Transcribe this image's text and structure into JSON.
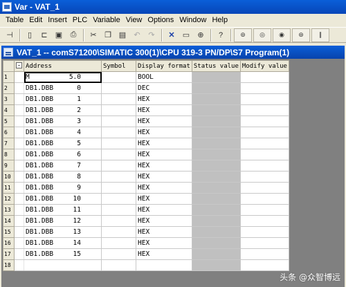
{
  "window": {
    "title": "Var - VAT_1"
  },
  "menu": [
    "Table",
    "Edit",
    "Insert",
    "PLC",
    "Variable",
    "View",
    "Options",
    "Window",
    "Help"
  ],
  "mdi": {
    "title": "VAT_1 -- comS71200\\SIMATIC 300(1)\\CPU 319-3 PN/DP\\S7 Program(1)"
  },
  "table": {
    "headers": [
      "Address",
      "Symbol",
      "Display format",
      "Status value",
      "Modify value"
    ],
    "rows": [
      {
        "num": "1",
        "addr": "M",
        "addr_num": "5.0",
        "format": "BOOL"
      },
      {
        "num": "2",
        "addr": "DB1.DBB",
        "addr_num": "0",
        "format": "DEC"
      },
      {
        "num": "3",
        "addr": "DB1.DBB",
        "addr_num": "1",
        "format": "HEX"
      },
      {
        "num": "4",
        "addr": "DB1.DBB",
        "addr_num": "2",
        "format": "HEX"
      },
      {
        "num": "5",
        "addr": "DB1.DBB",
        "addr_num": "3",
        "format": "HEX"
      },
      {
        "num": "6",
        "addr": "DB1.DBB",
        "addr_num": "4",
        "format": "HEX"
      },
      {
        "num": "7",
        "addr": "DB1.DBB",
        "addr_num": "5",
        "format": "HEX"
      },
      {
        "num": "8",
        "addr": "DB1.DBB",
        "addr_num": "6",
        "format": "HEX"
      },
      {
        "num": "9",
        "addr": "DB1.DBB",
        "addr_num": "7",
        "format": "HEX"
      },
      {
        "num": "10",
        "addr": "DB1.DBB",
        "addr_num": "8",
        "format": "HEX"
      },
      {
        "num": "11",
        "addr": "DB1.DBB",
        "addr_num": "9",
        "format": "HEX"
      },
      {
        "num": "12",
        "addr": "DB1.DBB",
        "addr_num": "10",
        "format": "HEX"
      },
      {
        "num": "13",
        "addr": "DB1.DBB",
        "addr_num": "11",
        "format": "HEX"
      },
      {
        "num": "14",
        "addr": "DB1.DBB",
        "addr_num": "12",
        "format": "HEX"
      },
      {
        "num": "15",
        "addr": "DB1.DBB",
        "addr_num": "13",
        "format": "HEX"
      },
      {
        "num": "16",
        "addr": "DB1.DBB",
        "addr_num": "14",
        "format": "HEX"
      },
      {
        "num": "17",
        "addr": "DB1.DBB",
        "addr_num": "15",
        "format": "HEX"
      },
      {
        "num": "18",
        "addr": "",
        "addr_num": "",
        "format": ""
      }
    ]
  },
  "watermark": "头条 @众智博远",
  "colors": {
    "titlebar": "#0a5fd8",
    "status_column": "#c0c0c0",
    "chrome": "#ece9d8"
  }
}
